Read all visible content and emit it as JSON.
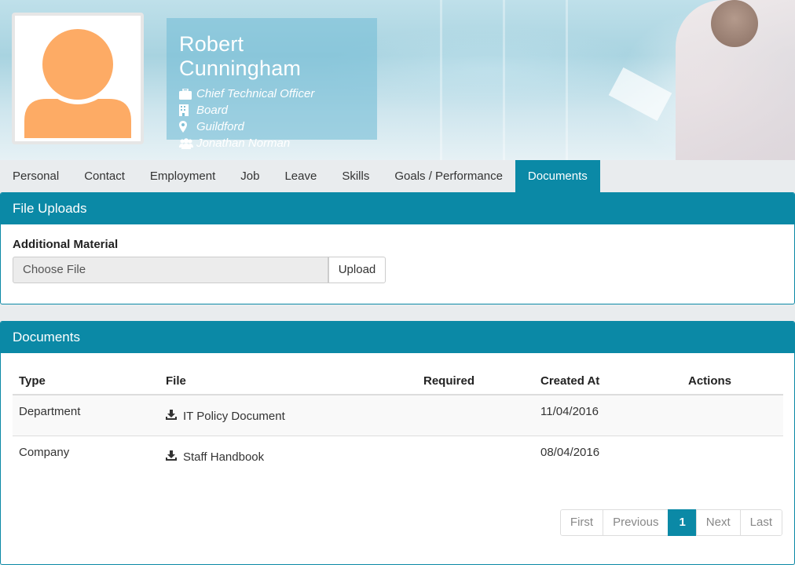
{
  "profile": {
    "name": "Robert Cunningham",
    "title": "Chief Technical Officer",
    "department": "Board",
    "location": "Guildford",
    "manager": "Jonathan Norman"
  },
  "tabs": [
    {
      "label": "Personal"
    },
    {
      "label": "Contact"
    },
    {
      "label": "Employment"
    },
    {
      "label": "Job"
    },
    {
      "label": "Leave"
    },
    {
      "label": "Skills"
    },
    {
      "label": "Goals / Performance"
    },
    {
      "label": "Documents",
      "active": true
    }
  ],
  "uploads": {
    "heading": "File Uploads",
    "field_label": "Additional Material",
    "file_input_text": "Choose File",
    "upload_label": "Upload"
  },
  "documents": {
    "heading": "Documents",
    "columns": [
      "Type",
      "File",
      "Required",
      "Created At",
      "Actions"
    ],
    "rows": [
      {
        "type": "Department",
        "file": "IT Policy Document",
        "required": "",
        "created_at": "11/04/2016"
      },
      {
        "type": "Company",
        "file": "Staff Handbook",
        "required": "",
        "created_at": "08/04/2016"
      }
    ]
  },
  "pagination": {
    "first": "First",
    "previous": "Previous",
    "current": "1",
    "next": "Next",
    "last": "Last"
  },
  "colors": {
    "accent": "#0b89a6",
    "avatar": "#fdab65"
  }
}
